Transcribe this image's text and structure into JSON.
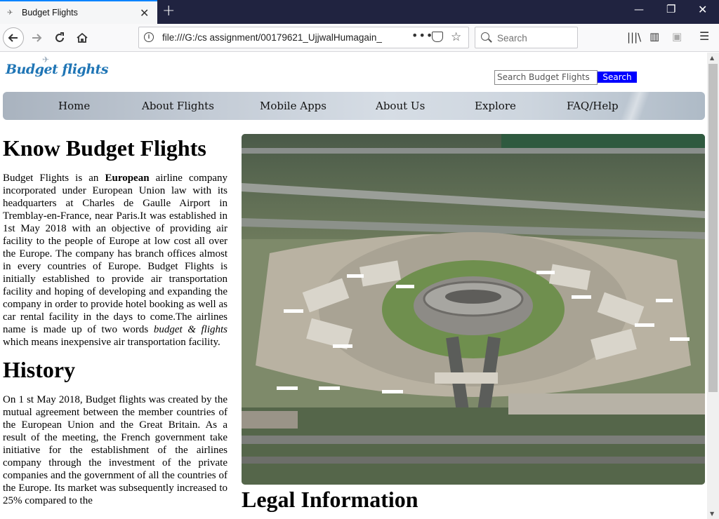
{
  "browser": {
    "tab_title": "Budget Flights",
    "url": "file:///G:/cs assignment/00179621_UjjwalHumagain_",
    "search_placeholder": "Search"
  },
  "site": {
    "logo_text": "Budget flights",
    "search_placeholder": "Search Budget Flights",
    "search_button": "Search",
    "menu": [
      "Home",
      "About Flights",
      "Mobile Apps",
      "About Us",
      "Explore",
      "FAQ/Help"
    ]
  },
  "content": {
    "heading1": "Know Budget Flights",
    "about_p1": "Budget Flights is an ",
    "about_bold": "European",
    "about_p2": " airline company incorporated under European Union law with its headquarters at Charles de Gaulle Airport in Tremblay-en-France, near Paris.It was established in 1st May 2018 with an objective of providing air facility to the people of Europe at low cost all over the Europe. The company has branch offices almost in every countries of Europe. Budget Flights is initially established to provide air transportation facility and hoping of developing and expanding the company in order to provide hotel booking as well as car rental facility in the days to come.The airlines name is made up of two words ",
    "about_italic": "budget & flights",
    "about_p3": " which means inexpensive air transportation facility.",
    "heading2": "History",
    "history_text": "On 1 st May 2018, Budget flights was created by the mutual agreement between the member countries of the European Union and the Great Britain. As a result of the meeting, the French government take initiative for the establishment of the airlines company through the investment of the private companies and the government of all the countries of the Europe. Its market was subsequently increased to 25% compared to the",
    "heading3": "Legal Information"
  },
  "colors": {
    "site_search_button": "#0000ff",
    "logo": "#1f75b5",
    "tabbar": "#202340",
    "tab_accent": "#0a84ff"
  }
}
